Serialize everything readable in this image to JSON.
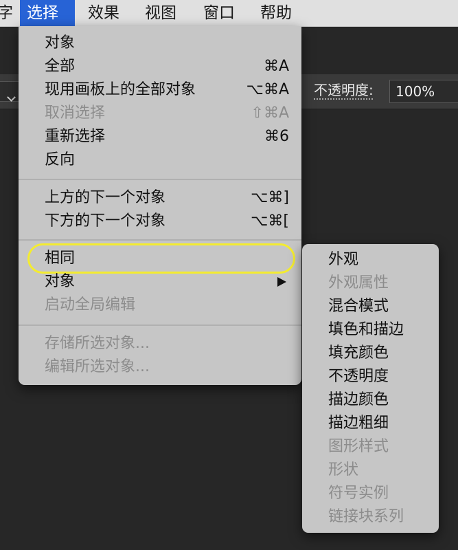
{
  "menubar": {
    "items": [
      {
        "label": "字",
        "active": false
      },
      {
        "label": "选择",
        "active": true
      },
      {
        "label": "效果",
        "active": false
      },
      {
        "label": "视图",
        "active": false
      },
      {
        "label": "窗口",
        "active": false
      },
      {
        "label": "帮助",
        "active": false
      }
    ],
    "active_color": "#2763d6"
  },
  "toolbar": {
    "opacity_label": "不透明度:",
    "opacity_value": "100%"
  },
  "select_menu": {
    "items": [
      {
        "label": "对象",
        "shortcut": "",
        "enabled": true
      },
      {
        "label": "全部",
        "shortcut": "⌘A",
        "enabled": true
      },
      {
        "label": "现用画板上的全部对象",
        "shortcut": "⌥⌘A",
        "enabled": true
      },
      {
        "label": "取消选择",
        "shortcut": "⇧⌘A",
        "enabled": false
      },
      {
        "label": "重新选择",
        "shortcut": "⌘6",
        "enabled": true
      },
      {
        "label": "反向",
        "shortcut": "",
        "enabled": true
      },
      {
        "label": "上方的下一个对象",
        "shortcut": "⌥⌘]",
        "enabled": true
      },
      {
        "label": "下方的下一个对象",
        "shortcut": "⌥⌘[",
        "enabled": true
      },
      {
        "label": "相同",
        "shortcut": "",
        "enabled": true,
        "highlighted": true
      },
      {
        "label": "对象",
        "shortcut": "",
        "enabled": true,
        "submenu": true
      },
      {
        "label": "启动全局编辑",
        "shortcut": "",
        "enabled": false
      },
      {
        "label": "存储所选对象...",
        "shortcut": "",
        "enabled": false
      },
      {
        "label": "编辑所选对象...",
        "shortcut": "",
        "enabled": false
      }
    ]
  },
  "same_submenu": {
    "items": [
      {
        "label": "外观",
        "enabled": true
      },
      {
        "label": "外观属性",
        "enabled": false
      },
      {
        "label": "混合模式",
        "enabled": true
      },
      {
        "label": "填色和描边",
        "enabled": true
      },
      {
        "label": "填充颜色",
        "enabled": true
      },
      {
        "label": "不透明度",
        "enabled": true
      },
      {
        "label": "描边颜色",
        "enabled": true
      },
      {
        "label": "描边粗细",
        "enabled": true
      },
      {
        "label": "图形样式",
        "enabled": false
      },
      {
        "label": "形状",
        "enabled": false
      },
      {
        "label": "符号实例",
        "enabled": false
      },
      {
        "label": "链接块系列",
        "enabled": false
      }
    ]
  },
  "highlight_color": "#f4ec2f"
}
